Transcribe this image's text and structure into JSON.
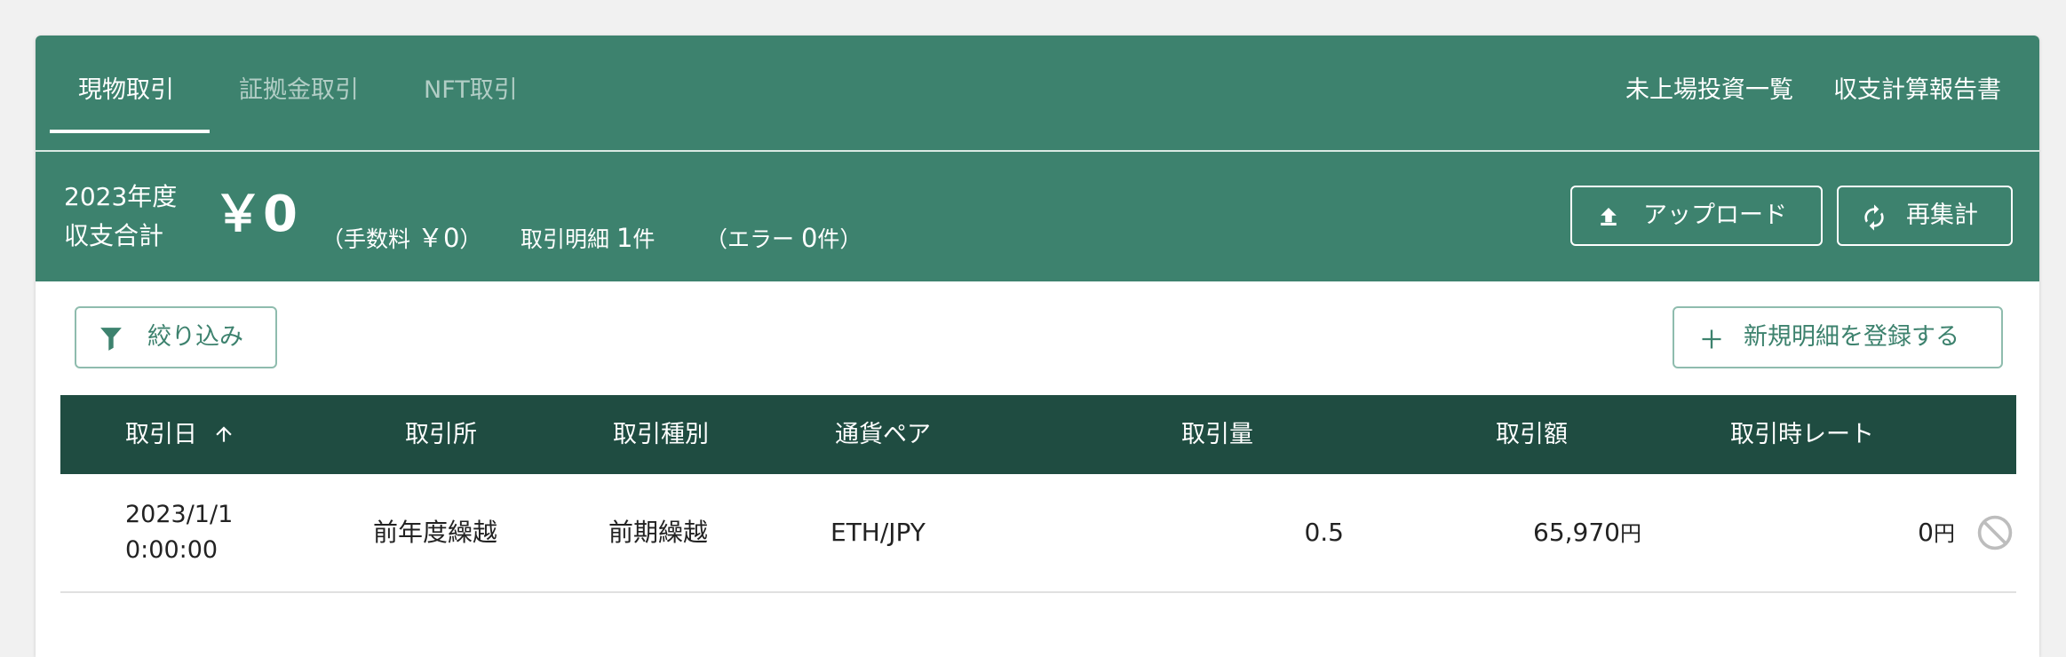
{
  "tabs": {
    "spot": "現物取引",
    "margin": "証拠金取引",
    "nft": "NFT取引"
  },
  "top_links": {
    "unlisted": "未上場投資一覧",
    "report": "収支計算報告書"
  },
  "summary": {
    "year_label": "2023年度",
    "total_label": "収支合計",
    "total_value": "￥0",
    "fee_prefix": "（手数料",
    "fee_value": "￥0",
    "fee_suffix": "）",
    "detail_label": "取引明細",
    "detail_count": "1",
    "detail_unit": "件",
    "error_prefix": "（エラー",
    "error_count": "0",
    "error_unit": "件）"
  },
  "actions": {
    "upload": "アップロード",
    "recalc": "再集計",
    "filter": "絞り込み",
    "new_entry": "新規明細を登録する"
  },
  "table": {
    "columns": {
      "date": "取引日",
      "exchange": "取引所",
      "type": "取引種別",
      "pair": "通貨ペア",
      "amount": "取引量",
      "value": "取引額",
      "rate": "取引時レート"
    },
    "rows": [
      {
        "date": "2023/1/1",
        "time": "0:00:00",
        "exchange": "前年度繰越",
        "type": "前期繰越",
        "pair": "ETH/JPY",
        "amount": "0.5",
        "value": "65,970",
        "value_unit": "円",
        "rate": "0",
        "rate_unit": "円"
      }
    ]
  },
  "colors": {
    "primary": "#3d826e",
    "header_dark": "#1f4c41",
    "outline": "#8fbcae"
  },
  "icons": {
    "sort": "arrow-up-icon",
    "upload": "upload-icon",
    "recalc": "refresh-icon",
    "filter": "filter-icon",
    "add": "plus-icon",
    "row_action": "block-icon"
  }
}
